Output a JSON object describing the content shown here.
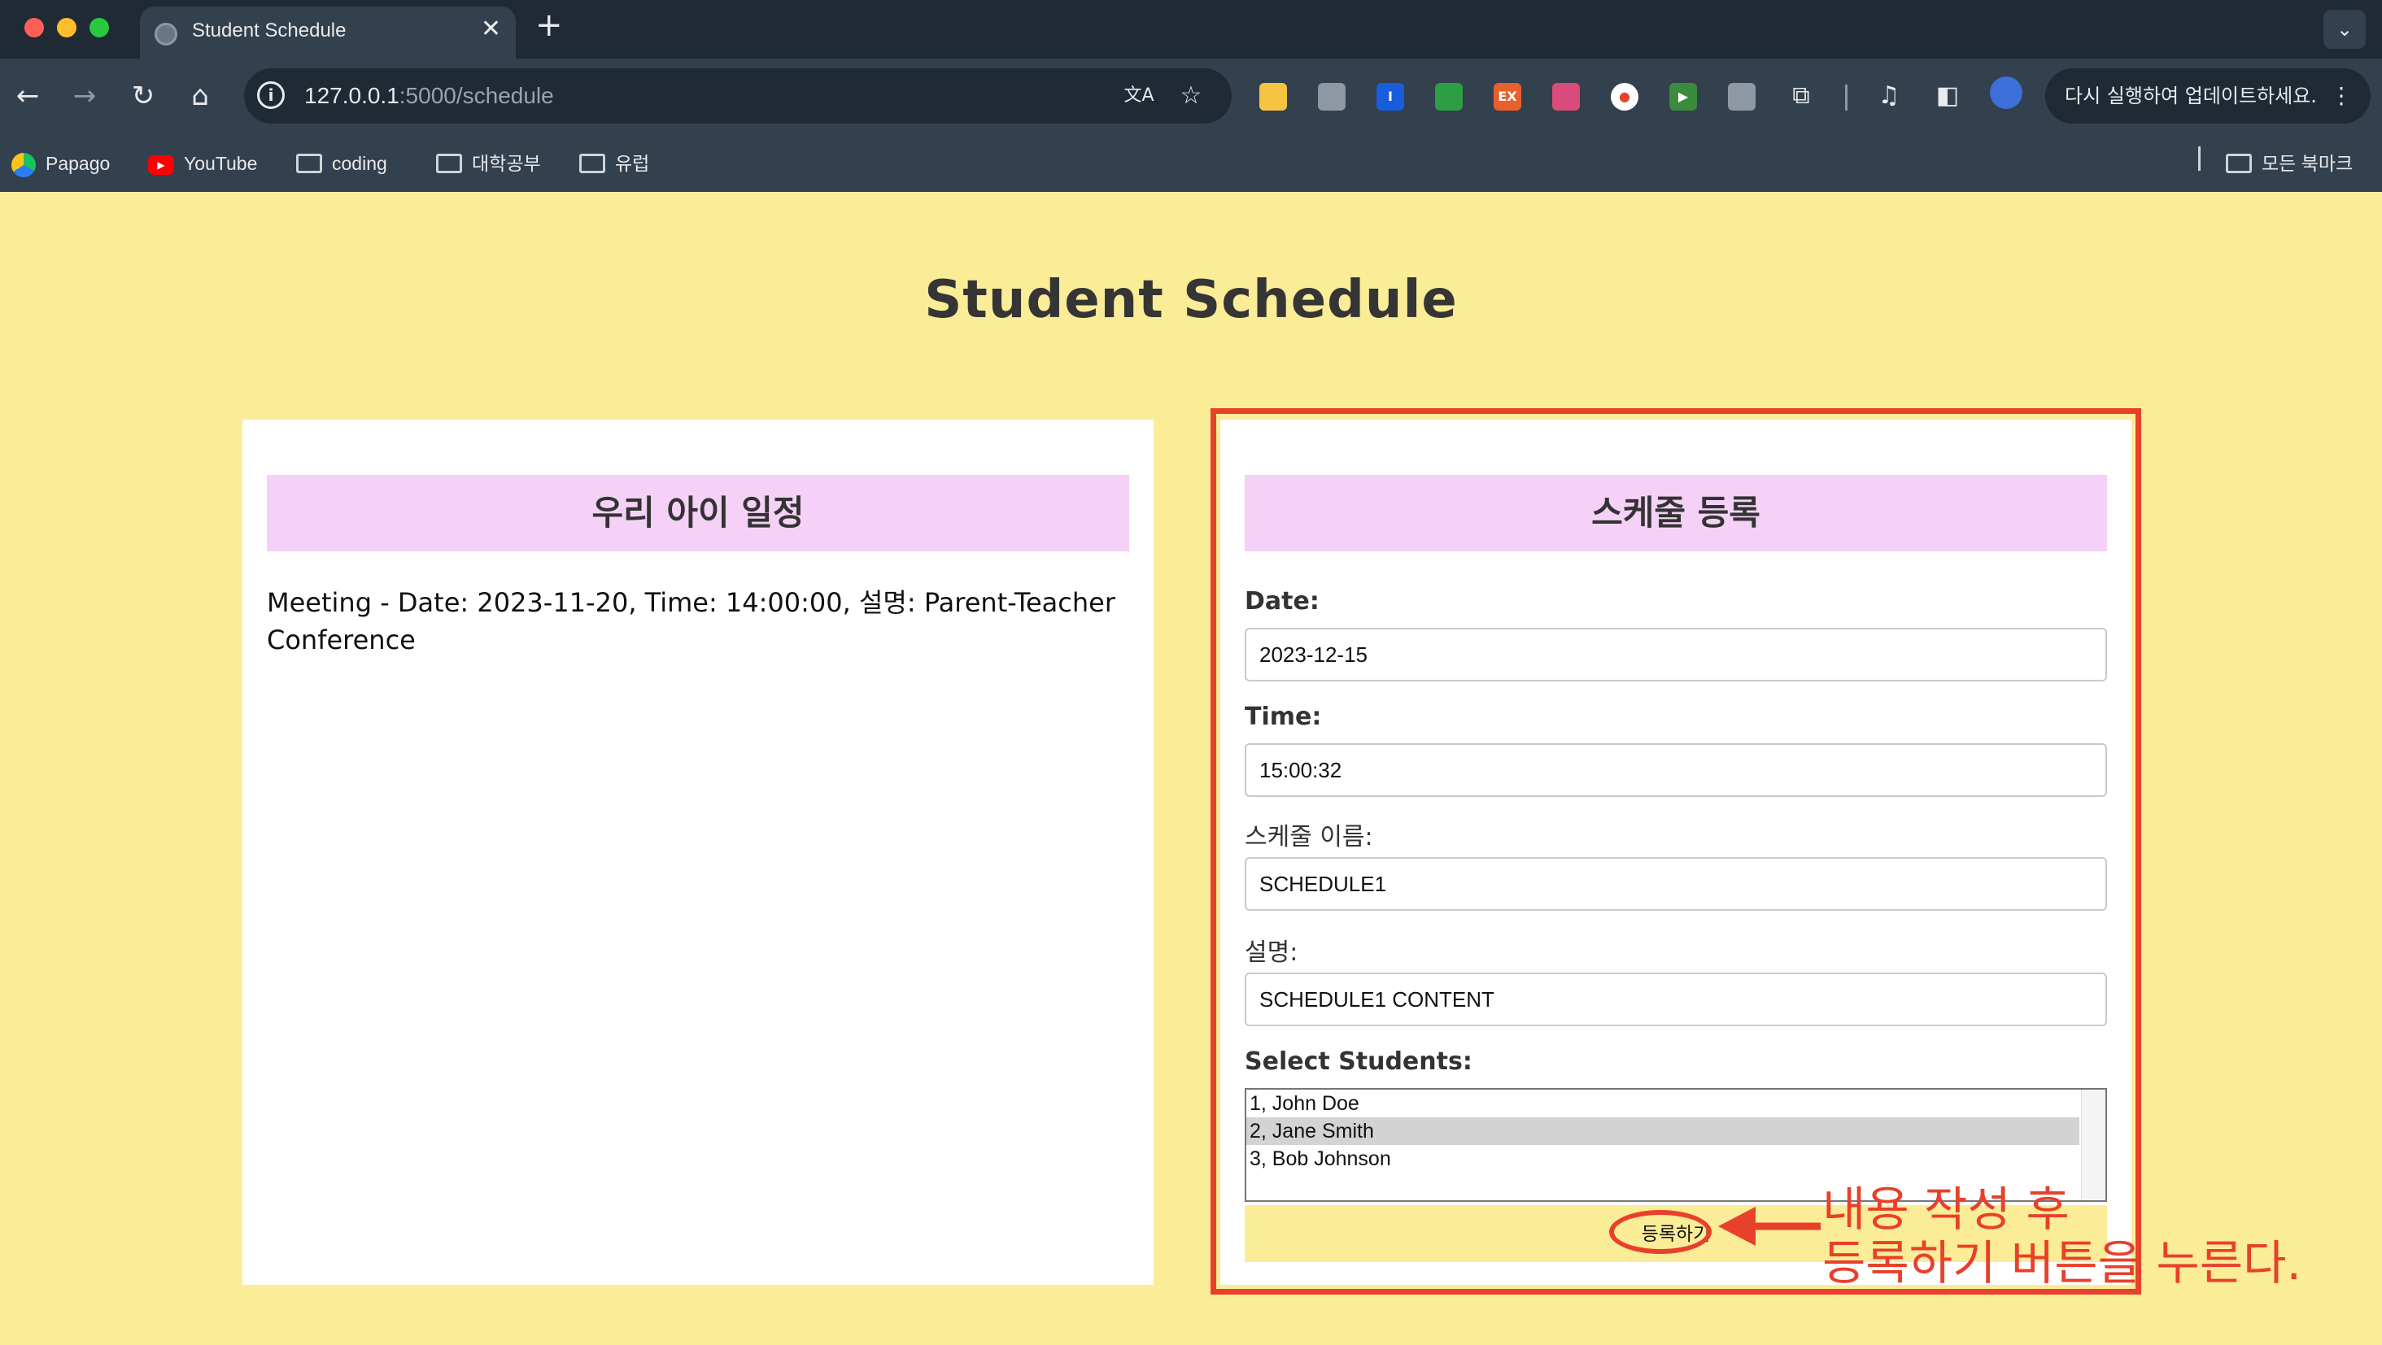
{
  "browser": {
    "tab_title": "Student Schedule",
    "tab_close": "✕",
    "new_tab": "+",
    "tab_menu": "⌄",
    "url_host": "127.0.0.1",
    "url_path": ":5000/schedule",
    "update_button": "다시 실행하여 업데이트하세요.",
    "update_menu": "⋮",
    "bookmarks": [
      {
        "label": "Papago",
        "icon": "papago-icon"
      },
      {
        "label": "YouTube",
        "icon": "youtube-icon"
      },
      {
        "label": "coding",
        "icon": "folder-icon"
      },
      {
        "label": "대학공부",
        "icon": "folder-icon"
      },
      {
        "label": "유럽",
        "icon": "folder-icon"
      }
    ],
    "all_bookmarks": "모든 북마크",
    "extensions": [
      {
        "name": "note-extension-icon",
        "text": "",
        "color": "#f5c542"
      },
      {
        "name": "camera-extension-icon",
        "text": "",
        "color": "#8d98a4"
      },
      {
        "name": "bitwarden-extension-icon",
        "text": "I",
        "color": "#175ddc"
      },
      {
        "name": "green-extension-icon",
        "text": "",
        "color": "#2e9e44"
      },
      {
        "name": "ex-extension-icon",
        "text": "EX",
        "color": "#e9612a"
      },
      {
        "name": "palette-extension-icon",
        "text": "",
        "color": "#d94b7a"
      },
      {
        "name": "record-extension-icon",
        "text": "●",
        "color": "#ffffff"
      },
      {
        "name": "play-extension-icon",
        "text": "▶",
        "color": "#3c8a3c"
      },
      {
        "name": "cursor-extension-icon",
        "text": "",
        "color": "#8d98a4"
      }
    ]
  },
  "page": {
    "title": "Student Schedule",
    "left_card": {
      "heading": "우리 아이 일정",
      "entries": [
        "Meeting - Date: 2023-11-20, Time: 14:00:00, 설명: Parent-Teacher Conference"
      ]
    },
    "right_card": {
      "heading": "스케줄 등록",
      "fields": {
        "date": {
          "label": "Date:",
          "value": "2023-12-15"
        },
        "time": {
          "label": "Time:",
          "value": "15:00:32"
        },
        "name": {
          "label": "스케줄 이름:",
          "value": "SCHEDULE1"
        },
        "description": {
          "label": "설명:",
          "value": "SCHEDULE1 CONTENT"
        }
      },
      "students_label": "Select Students:",
      "students": [
        {
          "label": "1, John Doe",
          "selected": false
        },
        {
          "label": "2, Jane Smith",
          "selected": true
        },
        {
          "label": "3, Bob Johnson",
          "selected": false
        }
      ],
      "submit_label": "등록하기"
    }
  },
  "annotation": {
    "line1": "내용 작성 후",
    "line2": "등록하기 버튼을 누른다.",
    "color": "#e8402a"
  }
}
